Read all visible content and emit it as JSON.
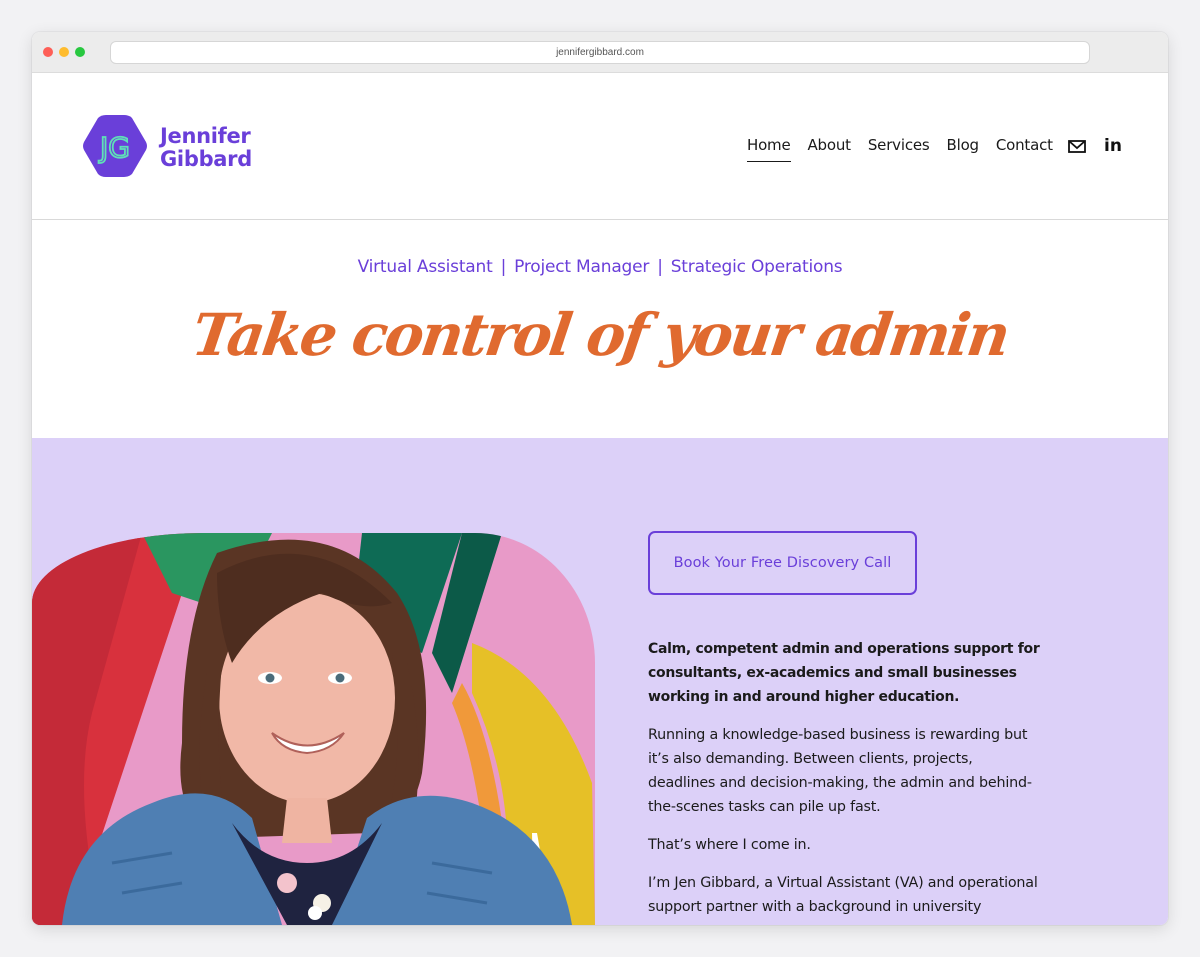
{
  "browser": {
    "url": "jennifergibbard.com"
  },
  "header": {
    "logo_monogram": "JG",
    "logo_line1": "Jennifer",
    "logo_line2": "Gibbard",
    "nav": [
      "Home",
      "About",
      "Services",
      "Blog",
      "Contact"
    ],
    "active_nav": "Home",
    "social_icons": [
      "mail-icon",
      "linkedin-icon"
    ],
    "linkedin_glyph": "in"
  },
  "tagline": {
    "roles": [
      "Virtual Assistant",
      "Project Manager",
      "Strategic Operations"
    ],
    "separator": "|",
    "heading": "Take control of your admin"
  },
  "hero": {
    "cta": "Book Your Free Discovery Call",
    "lead": "Calm, competent admin and operations support for consultants, ex-academics and small businesses working in and around higher education.",
    "para1": "Running a knowledge-based business is rewarding but it’s also demanding. Between clients, projects, deadlines and decision-making, the admin and behind-the-scenes tasks can pile up fast.",
    "para2": "That’s where I come in.",
    "para3": "I’m Jen Gibbard, a Virtual Assistant (VA) and operational support partner with a background in university"
  },
  "colors": {
    "brand_purple": "#6a3fd9",
    "accent_orange": "#e06a2f",
    "hero_bg": "#dcd0f8",
    "logo_teal": "#5fe0b8"
  }
}
